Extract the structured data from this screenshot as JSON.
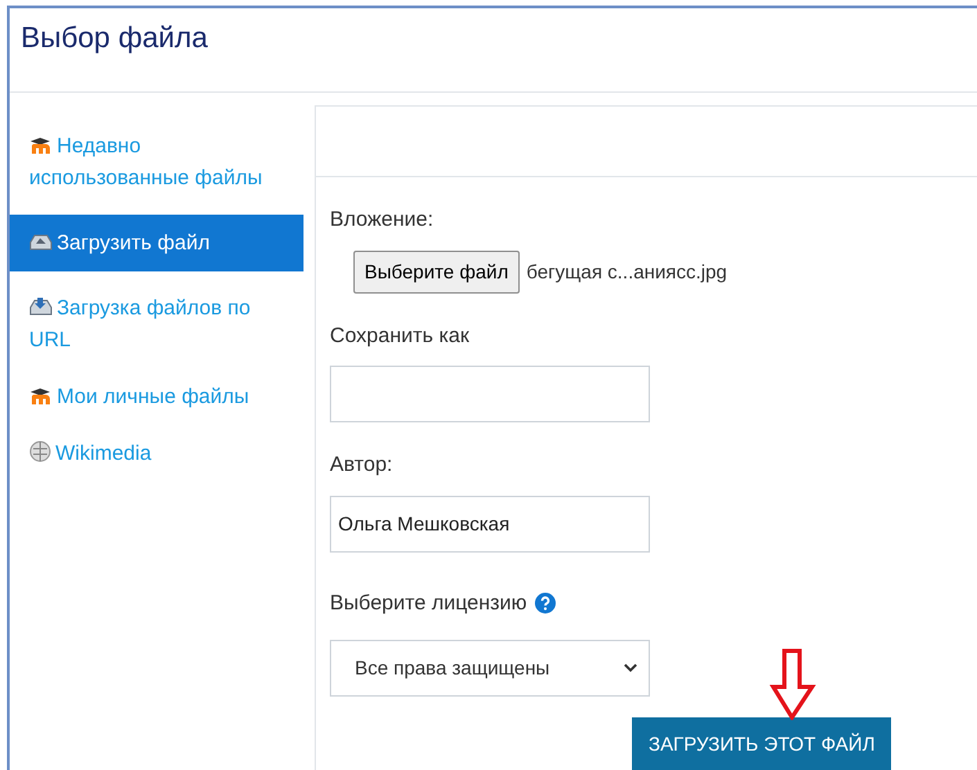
{
  "dialog": {
    "title": "Выбор файла"
  },
  "sidebar": {
    "items": [
      {
        "label": "Недавно использованные файлы",
        "kind": "moodle",
        "selected": false
      },
      {
        "label": "Загрузить файл",
        "kind": "upload",
        "selected": true
      },
      {
        "label": "Загрузка файлов по URL",
        "kind": "url",
        "selected": false
      },
      {
        "label": "Мои личные файлы",
        "kind": "moodle",
        "selected": false
      },
      {
        "label": "Wikimedia",
        "kind": "wiki",
        "selected": false
      }
    ]
  },
  "form": {
    "attachment_label": "Вложение:",
    "choose_button": "Выберите файл",
    "file_name": "бегущая с...аниясc.jpg",
    "save_as_label": "Сохранить как",
    "author_label": "Автор:",
    "author_value": "Ольга Мешковская",
    "license_label": "Выберите лицензию",
    "license_value": "Все права защищены",
    "submit_button": "ЗАГРУЗИТЬ ЭТОТ ФАЙЛ"
  }
}
